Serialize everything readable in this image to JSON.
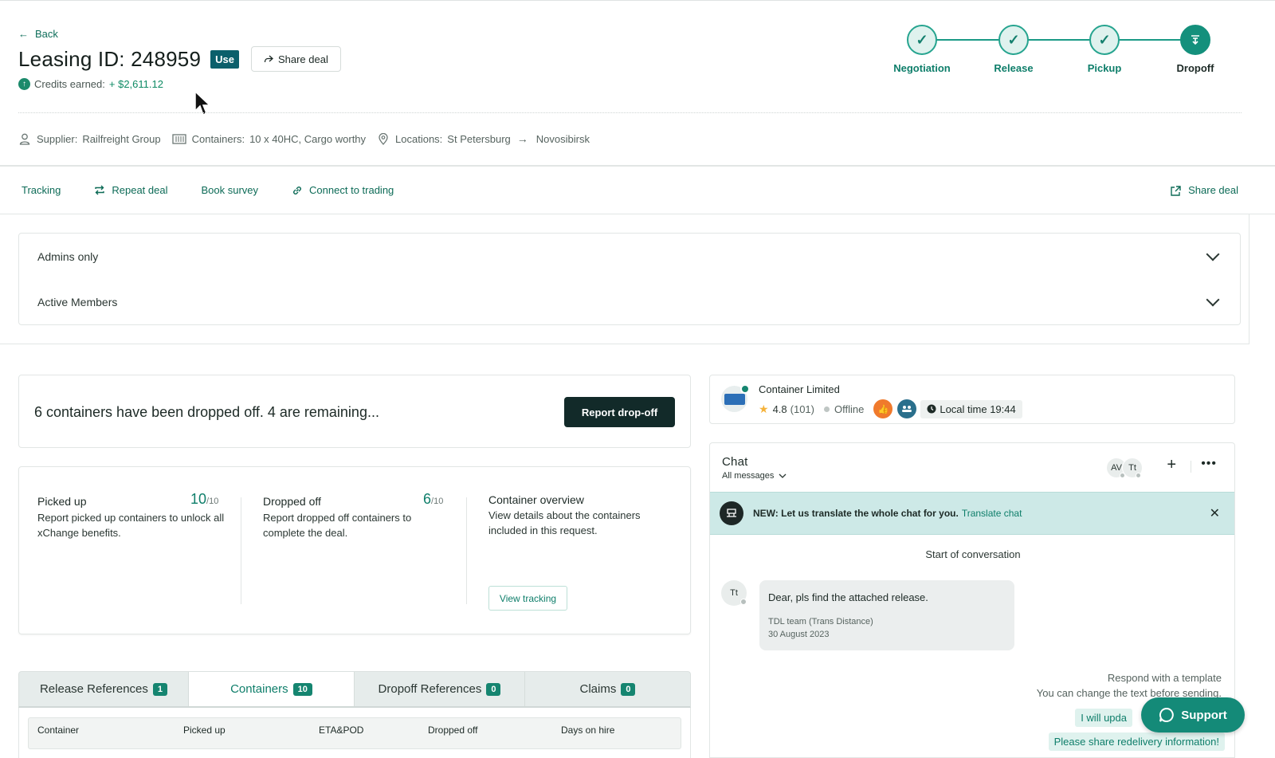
{
  "header": {
    "back_label": "Back",
    "title": "Leasing ID: 248959",
    "use_badge": "Use",
    "share_label": "Share deal",
    "credits_label": "Credits earned:",
    "credits_amount": "+ $2,611.12"
  },
  "steps": [
    {
      "label": "Negotiation",
      "status": "done"
    },
    {
      "label": "Release",
      "status": "done"
    },
    {
      "label": "Pickup",
      "status": "done"
    },
    {
      "label": "Dropoff",
      "status": "current"
    }
  ],
  "info": {
    "supplier_label": "Supplier:",
    "supplier_value": "Railfreight Group",
    "containers_label": "Containers:",
    "containers_value": "10 x 40HC, Cargo worthy",
    "locations_label": "Locations:",
    "from": "St Petersburg",
    "to": "Novosibirsk"
  },
  "actions": {
    "tracking": "Tracking",
    "repeat": "Repeat deal",
    "survey": "Book survey",
    "connect": "Connect to trading",
    "share": "Share deal"
  },
  "accordion": {
    "admins": "Admins only",
    "members": "Active Members"
  },
  "status": {
    "text": "6 containers have been dropped off. 4 are remaining...",
    "button": "Report drop-off"
  },
  "summary": {
    "picked": {
      "title": "Picked up",
      "count": "10",
      "total": "/10",
      "desc": "Report picked up containers to unlock all xChange benefits."
    },
    "dropped": {
      "title": "Dropped off",
      "count": "6",
      "total": "/10",
      "desc": "Report dropped off containers to complete the deal."
    },
    "overview": {
      "title": "Container overview",
      "desc": "View details about the containers included in this request.",
      "button": "View tracking"
    }
  },
  "tabs": [
    {
      "label": "Release References",
      "count": "1"
    },
    {
      "label": "Containers",
      "count": "10"
    },
    {
      "label": "Dropoff References",
      "count": "0"
    },
    {
      "label": "Claims",
      "count": "0"
    }
  ],
  "table": {
    "columns": [
      "Container",
      "Picked up",
      "ETA&POD",
      "Dropped off",
      "Days on hire"
    ]
  },
  "company": {
    "name": "Container Limited",
    "rating": "4.8",
    "reviews": "(101)",
    "status": "Offline",
    "local_time": "Local time 19:44"
  },
  "chat": {
    "title": "Chat",
    "filter": "All messages",
    "avatars": [
      "AV",
      "Tt"
    ],
    "banner_text": "NEW: Let us translate the whole chat for you.",
    "banner_link": "Translate chat",
    "start": "Start of conversation",
    "message": {
      "avatar": "Tt",
      "text": "Dear,  pls find the attached release.",
      "author": "TDL team (Trans Distance)",
      "date": "30 August 2023"
    },
    "respond_title": "Respond with a template",
    "respond_sub": "You can change the text before sending.",
    "chip1": "I will upda",
    "chip2": "Please share redelivery information!"
  },
  "support": {
    "label": "Support"
  },
  "colors": {
    "accent": "#0e7e6a",
    "dark_button": "#122a29",
    "banner": "#cde9e7"
  }
}
